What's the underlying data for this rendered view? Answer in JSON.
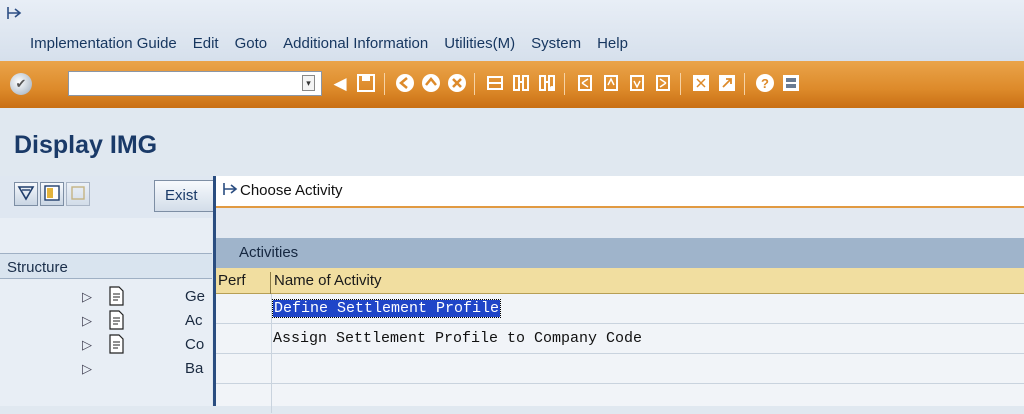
{
  "menu": {
    "items": [
      "Implementation Guide",
      "Edit",
      "Goto",
      "Additional Information",
      "Utilities(M)",
      "System",
      "Help"
    ]
  },
  "toolbar": {
    "command_value": "",
    "icons": [
      "enter-icon",
      "back-icon",
      "save-icon",
      "back-nav-icon",
      "exit-icon",
      "cancel-icon",
      "print-icon",
      "find-icon",
      "find-next-icon",
      "first-page-icon",
      "prev-page-icon",
      "next-page-icon",
      "last-page-icon",
      "new-session-icon",
      "shortcut-icon",
      "help-icon",
      "customize-layout-icon"
    ]
  },
  "page": {
    "title": "Display IMG"
  },
  "app_toolbar": {
    "exist_label": "Exist"
  },
  "structure": {
    "header": "Structure",
    "rows": [
      "Ge",
      "Ac",
      "Co",
      "Ba"
    ]
  },
  "dialog": {
    "title": "Choose Activity",
    "section": "Activities",
    "columns": {
      "perf": "Perf",
      "name": "Name of Activity"
    },
    "rows": [
      {
        "name": "Define Settlement Profile",
        "selected": true
      },
      {
        "name": "Assign Settlement Profile to Company Code",
        "selected": false
      }
    ]
  },
  "colors": {
    "accent": "#dd8a2a",
    "title": "#1a3a68",
    "selection": "#1f45c8"
  }
}
